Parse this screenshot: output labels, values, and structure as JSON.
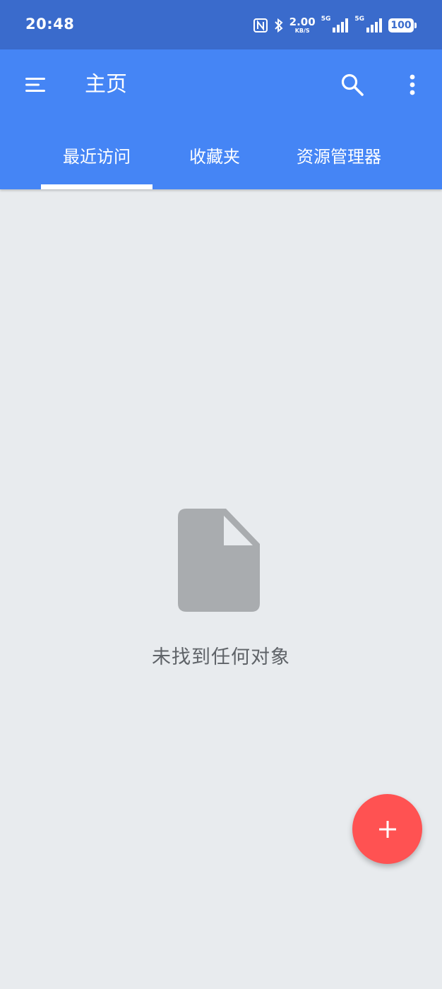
{
  "status_bar": {
    "time": "20:48",
    "net_speed": "2.00",
    "net_speed_unit": "KB/S",
    "sim1_label": "5G",
    "sim2_label": "5G",
    "battery": "100"
  },
  "app_bar": {
    "title": "主页",
    "icons": {
      "menu": "menu-icon",
      "search": "search-icon",
      "more": "more-vert-icon"
    }
  },
  "tabs": [
    {
      "label": "最近访问",
      "selected": true
    },
    {
      "label": "收藏夹",
      "selected": false
    },
    {
      "label": "资源管理器",
      "selected": false
    }
  ],
  "empty_state": {
    "icon": "file-icon",
    "message": "未找到任何对象"
  },
  "fab": {
    "icon": "plus-icon",
    "color": "#ff5252"
  },
  "colors": {
    "status_bar": "#3a6bcc",
    "app_bar": "#4585f5",
    "background": "#e8ebee",
    "empty_icon": "#a9acaf"
  }
}
